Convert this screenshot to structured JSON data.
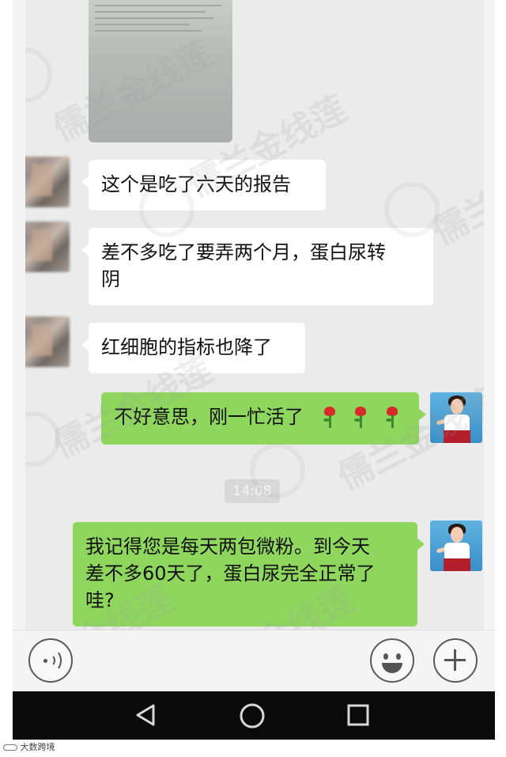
{
  "chat": {
    "messages": [
      {
        "side": "left",
        "text": "这个是吃了六天的报告"
      },
      {
        "side": "left",
        "text_line1": "差不多吃了要弄两个月，蛋白尿转",
        "text_line2": "阴"
      },
      {
        "side": "left",
        "text": "红细胞的指标也降了"
      },
      {
        "side": "right",
        "text": "不好意思，刚一忙活了"
      },
      {
        "side": "right",
        "text_line1": "我记得您是每天两包微粉。到今天",
        "text_line2": "差不多60天了，蛋白尿完全正常了",
        "text_line3": "哇?"
      }
    ],
    "timestamp": "14:08"
  },
  "watermark": {
    "text": "儒兰金线莲"
  },
  "input_bar": {
    "voice_icon": "voice-icon",
    "emoji_icon": "emoji-icon",
    "plus_icon": "plus-icon"
  },
  "nav_bar": {
    "back_icon": "back-triangle-icon",
    "home_icon": "home-circle-icon",
    "recents_icon": "recents-square-icon"
  },
  "footer": {
    "credit": "大数跨境"
  },
  "colors": {
    "chat_bg": "#ebebeb",
    "bubble_received": "#ffffff",
    "bubble_sent": "#8fd65f",
    "nav_bg": "#0b0b0b"
  }
}
